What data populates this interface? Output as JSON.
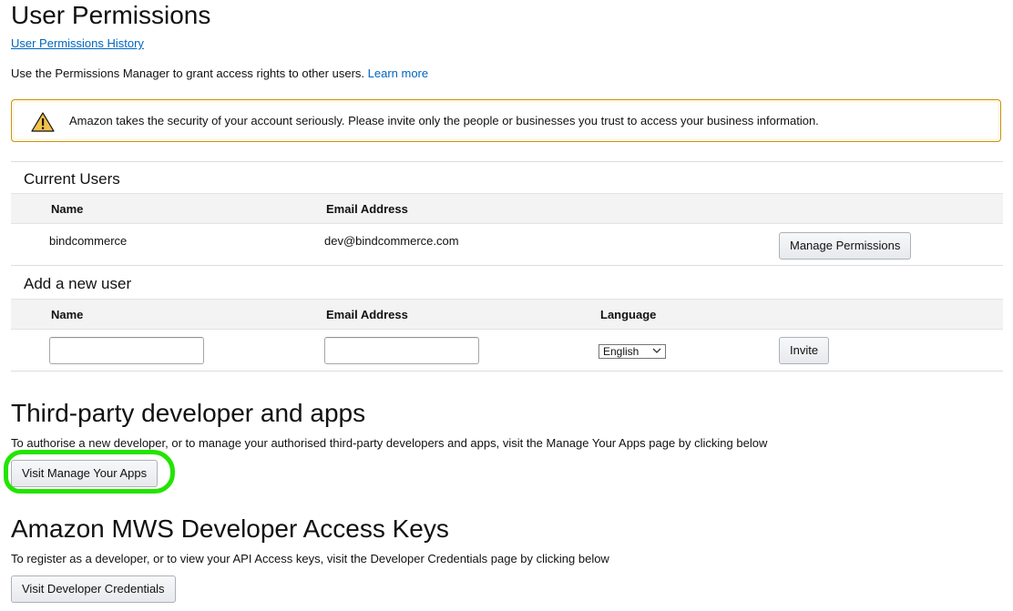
{
  "page": {
    "title": "User Permissions",
    "history_link": "User Permissions History",
    "intro_text": "Use the Permissions Manager to grant access rights to other users.",
    "learn_more": "Learn more"
  },
  "alert": {
    "icon": "warning-icon",
    "text": "Amazon takes the security of your account seriously. Please invite only the people or businesses you trust to access your business information."
  },
  "current_users": {
    "title": "Current Users",
    "columns": [
      "Name",
      "Email Address"
    ],
    "rows": [
      {
        "name": "bindcommerce",
        "email": "dev@bindcommerce.com",
        "action": "Manage Permissions"
      }
    ]
  },
  "add_user": {
    "title": "Add a new user",
    "columns": [
      "Name",
      "Email Address",
      "Language"
    ],
    "name_value": "",
    "email_value": "",
    "language_selected": "English",
    "invite_label": "Invite"
  },
  "third_party": {
    "heading": "Third-party developer and apps",
    "description": "To authorise a new developer, or to manage your authorised third-party developers and apps, visit the Manage Your Apps page by clicking below",
    "button_label": "Visit Manage Your Apps",
    "highlight_color": "#22e500"
  },
  "mws": {
    "heading": "Amazon MWS Developer Access Keys",
    "description": "To register as a developer, or to view your API Access keys, visit the Developer Credentials page by clicking below",
    "button_label": "Visit Developer Credentials"
  },
  "colors": {
    "link": "#0066c0",
    "alert_border": "#c89411",
    "warning_fill": "#f0c14b",
    "table_header_bg": "#f3f3f3"
  }
}
